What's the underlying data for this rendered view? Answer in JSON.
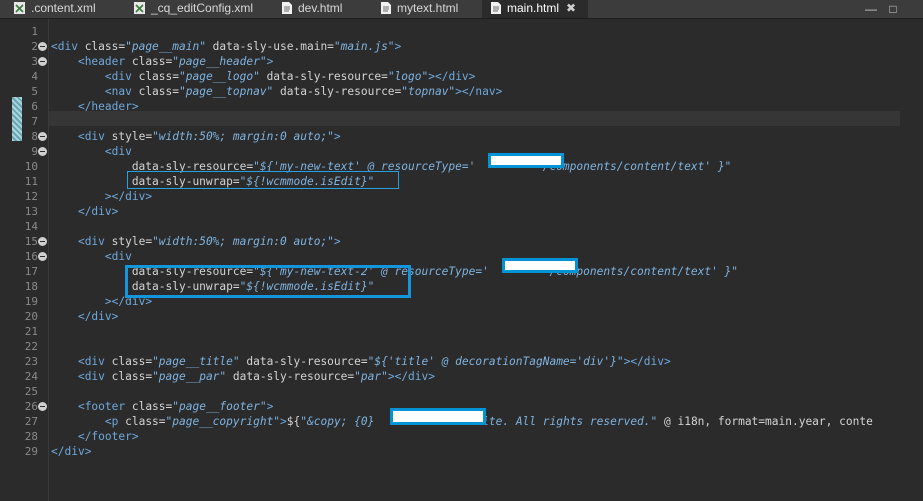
{
  "tabs": [
    {
      "label": ".content.xml",
      "icon": "xml-file-icon",
      "closable": false,
      "active": false
    },
    {
      "label": "_cq_editConfig.xml",
      "icon": "xml-file-icon",
      "closable": false,
      "active": false
    },
    {
      "label": "dev.html",
      "icon": "html-file-icon",
      "closable": false,
      "active": false
    },
    {
      "label": "mytext.html",
      "icon": "html-file-icon",
      "closable": false,
      "active": false
    },
    {
      "label": "main.html",
      "icon": "html-file-icon",
      "closable": true,
      "active": true
    }
  ],
  "window": {
    "minimize": "—",
    "maximize": "□"
  },
  "editor": {
    "current_line": 7,
    "lines": [
      {
        "n": "1",
        "code": ""
      },
      {
        "n": "2",
        "code": "<div class=\"page__main\" data-sly-use.main=\"main.js\">"
      },
      {
        "n": "3",
        "code": "    <header class=\"page__header\">"
      },
      {
        "n": "4",
        "code": "        <div class=\"page__logo\" data-sly-resource=\"logo\"></div>"
      },
      {
        "n": "5",
        "code": "        <nav class=\"page__topnav\" data-sly-resource=\"topnav\"></nav>"
      },
      {
        "n": "6",
        "code": "    </header>"
      },
      {
        "n": "7",
        "code": ""
      },
      {
        "n": "8",
        "code": "    <div style=\"width:50%; margin:0 auto;\">"
      },
      {
        "n": "9",
        "code": "        <div"
      },
      {
        "n": "10",
        "code": "            data-sly-resource=\"${'my-new-text' @ resourceType='          /components/content/text' }\""
      },
      {
        "n": "11",
        "code": "            data-sly-unwrap=\"${!wcmmode.isEdit}\""
      },
      {
        "n": "12",
        "code": "        ></div>"
      },
      {
        "n": "13",
        "code": "    </div>"
      },
      {
        "n": "14",
        "code": ""
      },
      {
        "n": "15",
        "code": "    <div style=\"width:50%; margin:0 auto;\">"
      },
      {
        "n": "16",
        "code": "        <div"
      },
      {
        "n": "17",
        "code": "            data-sly-resource=\"${'my-new-text-2' @ resourceType='         /components/content/text' }\""
      },
      {
        "n": "18",
        "code": "            data-sly-unwrap=\"${!wcmmode.isEdit}\""
      },
      {
        "n": "19",
        "code": "        ></div>"
      },
      {
        "n": "20",
        "code": "    </div>"
      },
      {
        "n": "21",
        "code": ""
      },
      {
        "n": "22",
        "code": ""
      },
      {
        "n": "23",
        "code": "    <div class=\"page__title\" data-sly-resource=\"${'title' @ decorationTagName='div'}\"></div>"
      },
      {
        "n": "24",
        "code": "    <div class=\"page__par\" data-sly-resource=\"par\"></div>"
      },
      {
        "n": "25",
        "code": ""
      },
      {
        "n": "26",
        "code": "    <footer class=\"page__footer\">"
      },
      {
        "n": "27",
        "code": "        <p class=\"page__copyright\">${\"&copy; {0}               Site. All rights reserved.\" @ i18n, format=main.year, conte"
      },
      {
        "n": "28",
        "code": "    </footer>"
      },
      {
        "n": "29",
        "code": "</div>"
      }
    ]
  }
}
